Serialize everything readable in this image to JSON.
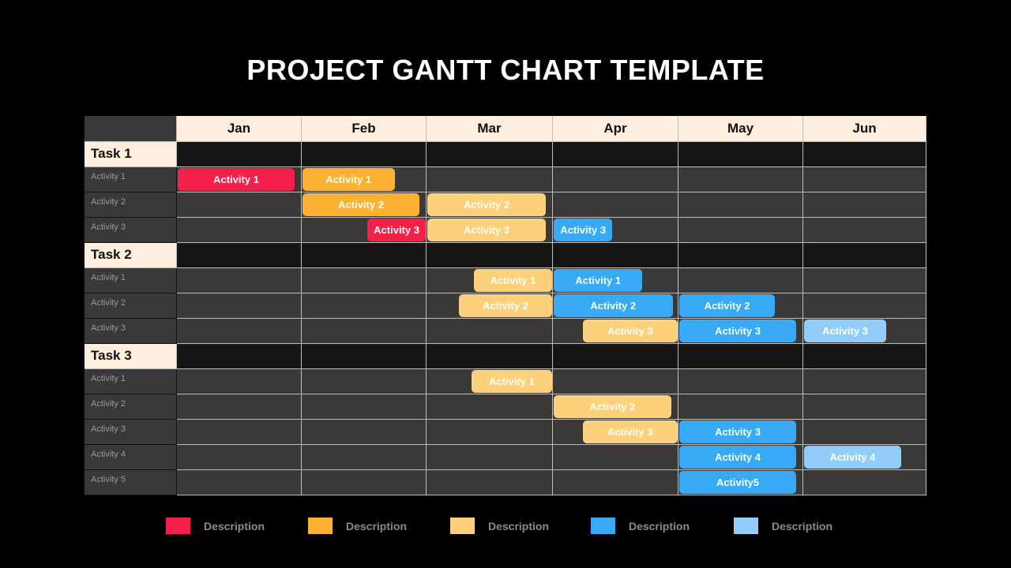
{
  "title": "PROJECT GANTT CHART TEMPLATE",
  "colors": {
    "red": "#f5204a",
    "orange": "#fbb232",
    "light_orange": "#fdd17c",
    "blue": "#38a9f5",
    "light_blue": "#92cdfa"
  },
  "chart_data": {
    "type": "gantt",
    "title": "PROJECT GANTT CHART TEMPLATE",
    "months": [
      "Jan",
      "Feb",
      "Mar",
      "Apr",
      "May",
      "Jun"
    ],
    "time_unit": "months from start of Jan (0 = Jan start, 6 = Jun end)",
    "groups": [
      {
        "task": "Task 1",
        "rows": [
          {
            "label": "Activity 1",
            "bars": [
              {
                "text": "Activity 1",
                "start": 0.0,
                "end": 0.95,
                "color": "red"
              },
              {
                "text": "Activity 1",
                "start": 1.0,
                "end": 1.75,
                "color": "orange"
              }
            ]
          },
          {
            "label": "Activity 2",
            "bars": [
              {
                "text": "Activity 2",
                "start": 1.0,
                "end": 1.95,
                "color": "orange"
              },
              {
                "text": "Activity 2",
                "start": 2.0,
                "end": 2.95,
                "color": "light_orange"
              }
            ]
          },
          {
            "label": "Activity 3",
            "bars": [
              {
                "text": "Activity 3",
                "start": 1.52,
                "end": 2.0,
                "color": "red"
              },
              {
                "text": "Activity 3",
                "start": 2.0,
                "end": 2.95,
                "color": "light_orange"
              },
              {
                "text": "Activity 3",
                "start": 3.0,
                "end": 3.48,
                "color": "blue"
              }
            ]
          }
        ]
      },
      {
        "task": "Task 2",
        "rows": [
          {
            "label": "Activity 1",
            "bars": [
              {
                "text": "Activity 1",
                "start": 2.37,
                "end": 3.0,
                "color": "light_orange"
              },
              {
                "text": "Activity 1",
                "start": 3.0,
                "end": 3.72,
                "color": "blue"
              }
            ]
          },
          {
            "label": "Activity 2",
            "bars": [
              {
                "text": "Activity 2",
                "start": 2.25,
                "end": 3.0,
                "color": "light_orange"
              },
              {
                "text": "Activity 2",
                "start": 3.0,
                "end": 3.96,
                "color": "blue"
              },
              {
                "text": "Activity 2",
                "start": 4.0,
                "end": 4.78,
                "color": "blue"
              }
            ]
          },
          {
            "label": "Activity 3",
            "bars": [
              {
                "text": "Activity 3",
                "start": 3.23,
                "end": 4.0,
                "color": "light_orange"
              },
              {
                "text": "Activity 3",
                "start": 4.0,
                "end": 4.95,
                "color": "blue"
              },
              {
                "text": "Activity 3",
                "start": 5.0,
                "end": 5.68,
                "color": "light_blue"
              }
            ]
          }
        ]
      },
      {
        "task": "Task 3",
        "rows": [
          {
            "label": "Activity 1",
            "bars": [
              {
                "text": "Activity 1",
                "start": 2.35,
                "end": 3.0,
                "color": "light_orange"
              }
            ]
          },
          {
            "label": "Activity 2",
            "bars": [
              {
                "text": "Activity 2",
                "start": 3.0,
                "end": 3.95,
                "color": "light_orange"
              }
            ]
          },
          {
            "label": "Activity 3",
            "bars": [
              {
                "text": "Activity 3",
                "start": 3.23,
                "end": 4.0,
                "color": "light_orange"
              },
              {
                "text": "Activity 3",
                "start": 4.0,
                "end": 4.95,
                "color": "blue"
              }
            ]
          },
          {
            "label": "Activity 4",
            "bars": [
              {
                "text": "Activity 4",
                "start": 4.0,
                "end": 4.95,
                "color": "blue"
              },
              {
                "text": "Activity 4",
                "start": 5.0,
                "end": 5.8,
                "color": "light_blue"
              }
            ]
          },
          {
            "label": "Activity 5",
            "bars": [
              {
                "text": "Activity5",
                "start": 4.0,
                "end": 4.95,
                "color": "blue"
              }
            ]
          }
        ]
      }
    ],
    "legend": [
      {
        "color": "red",
        "label": "Description"
      },
      {
        "color": "orange",
        "label": "Description"
      },
      {
        "color": "light_orange",
        "label": "Description"
      },
      {
        "color": "blue",
        "label": "Description"
      },
      {
        "color": "light_blue",
        "label": "Description"
      }
    ],
    "legend_position": "bottom"
  }
}
